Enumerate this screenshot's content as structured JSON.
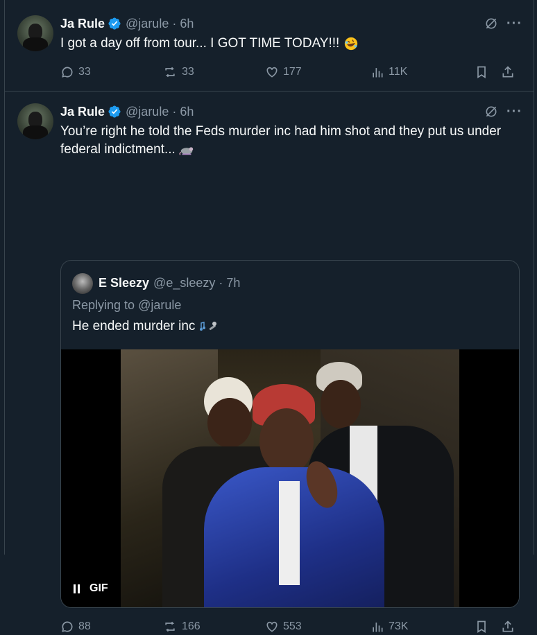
{
  "tweets": [
    {
      "name": "Ja Rule",
      "handle": "@jarule",
      "time": "6h",
      "text": "I got a day off from tour... I GOT TIME TODAY!!!",
      "emoji": "rolling-on-floor-laughing",
      "stats": {
        "replies": "33",
        "retweets": "33",
        "likes": "177",
        "views": "11K"
      }
    },
    {
      "name": "Ja Rule",
      "handle": "@jarule",
      "time": "6h",
      "text": "You’re right he told the Feds murder inc had him shot and they put us under federal indictment...",
      "emoji": "rat",
      "quote": {
        "name": "E Sleezy",
        "handle": "@e_sleezy",
        "time": "7h",
        "replying_prefix": "Replying to",
        "replying_to": "@jarule",
        "text": "He ended murder inc",
        "emoji": "musical-notes-microphone",
        "media_label": "GIF"
      },
      "stats": {
        "replies": "88",
        "retweets": "166",
        "likes": "553",
        "views": "73K"
      }
    }
  ],
  "colors": {
    "background": "#15202b",
    "border": "#38444d",
    "muted": "#8b98a5",
    "verified": "#1d9bf0"
  }
}
